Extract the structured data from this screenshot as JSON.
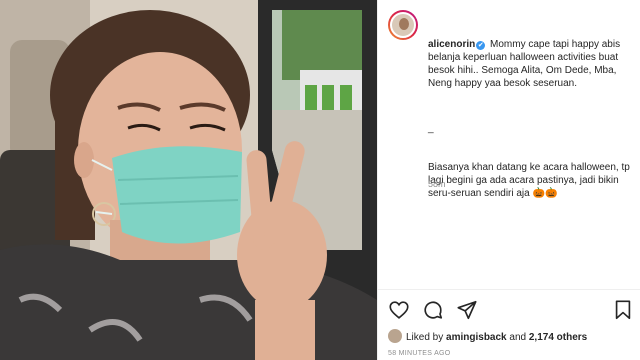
{
  "post": {
    "username": "alicenorin",
    "verified_glyph": "✔",
    "caption_p1": "Mommy cape tapi happy abis belanja keperluan halloween activities buat besok hihi.. Semoga Alita, Om Dede, Mba, Neng happy yaa besok seseruan.",
    "caption_dash": "_",
    "caption_p2": "Biasanya khan datang ke acara halloween, tp lagi begini ga ada acara pastinya, jadi bikin seru-seruan sendiri aja",
    "caption_emoji": "🎃🎃",
    "time_ago": "58m",
    "likes": {
      "prefix": "Liked by",
      "liked_by": "amingisback",
      "and": "and",
      "count": "2,174 others"
    },
    "post_age": "58 MINUTES AGO"
  },
  "icons": {
    "like": "heart-icon",
    "comment": "comment-icon",
    "share": "share-icon",
    "save": "bookmark-icon"
  },
  "colors": {
    "verified": "#3897f0",
    "text": "#262626",
    "muted": "#8e8e8e",
    "mask": "#7fd3c4"
  }
}
